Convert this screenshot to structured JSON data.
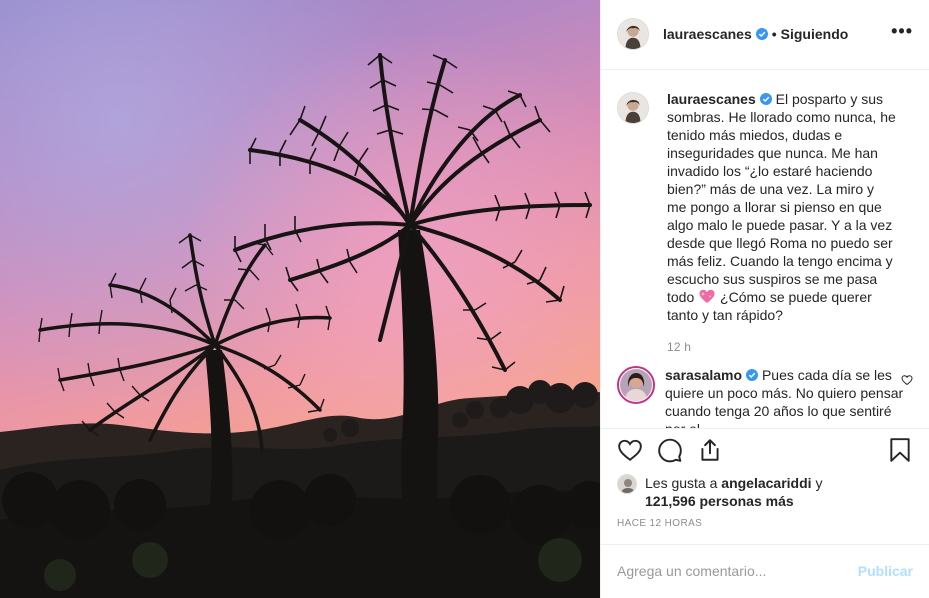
{
  "colors": {
    "verified": "#3897f0",
    "publish_disabled": "#b2dffc",
    "meta_grey": "#8e8e8e",
    "story_ring": "#c13584"
  },
  "photo": {
    "alt_icon": "sunset-palm-trees-photo"
  },
  "header": {
    "username": "lauraescanes",
    "separator": "•",
    "follow_label": "Siguiendo",
    "more_label": "•••",
    "more_icon": "more-options-icon"
  },
  "caption": {
    "username": "lauraescanes",
    "text_part1": "El posparto y sus sombras. He llorado como nunca, he tenido más miedos, dudas e inseguridades que nunca. Me han invadido los “¿lo estaré haciendo bien?” más de una vez. La miro y me pongo a llorar si pienso en que algo malo le puede pasar. Y a la vez desde que llegó Roma no puedo ser más feliz. Cuando la tengo encima y escucho sus suspiros se me pasa todo",
    "emoji_icon": "sparkling-heart-icon",
    "text_part2": "¿Cómo se puede querer tanto y tan rápido?",
    "time": "12 h"
  },
  "comment": {
    "username": "sarasalamo",
    "text": "Pues cada día se les quiere un poco más. No quiero pensar cuando tenga 20 años lo que sentiré por el"
  },
  "actions": {
    "like_icon": "heart-icon",
    "comment_icon": "comment-icon",
    "share_icon": "share-icon",
    "save_icon": "bookmark-icon"
  },
  "likes": {
    "prefix": "Les gusta a",
    "user": "angelacariddi",
    "joiner": "y",
    "count": "121,596 personas más"
  },
  "posted_ago": "HACE 12 HORAS",
  "comment_box": {
    "placeholder": "Agrega un comentario...",
    "publish_label": "Publicar"
  }
}
